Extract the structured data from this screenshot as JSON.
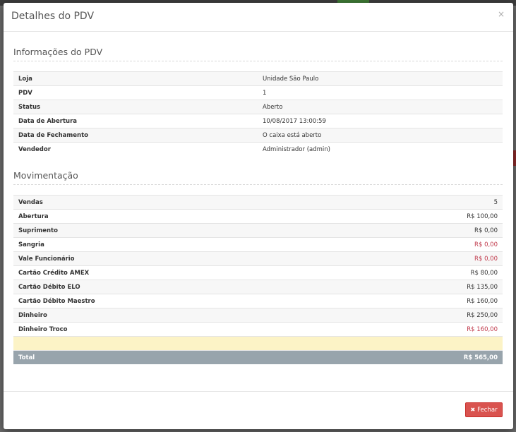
{
  "modal": {
    "title": "Detalhes do PDV",
    "close_glyph": "×",
    "close_button_label": "Fechar"
  },
  "info_section": {
    "title": "Informações do PDV",
    "rows": [
      {
        "label": "Loja",
        "value": "Unidade São Paulo"
      },
      {
        "label": "PDV",
        "value": "1"
      },
      {
        "label": "Status",
        "value": "Aberto"
      },
      {
        "label": "Data de Abertura",
        "value": "10/08/2017 13:00:59"
      },
      {
        "label": "Data de Fechamento",
        "value": "O caixa está aberto"
      },
      {
        "label": "Vendedor",
        "value": "Administrador (admin)"
      }
    ]
  },
  "mov_section": {
    "title": "Movimentação",
    "rows": [
      {
        "label": "Vendas",
        "value": "5",
        "negative": false
      },
      {
        "label": "Abertura",
        "value": "R$ 100,00",
        "negative": false
      },
      {
        "label": "Suprimento",
        "value": "R$ 0,00",
        "negative": false
      },
      {
        "label": "Sangria",
        "value": "R$ 0,00",
        "negative": true
      },
      {
        "label": "Vale Funcionário",
        "value": "R$ 0,00",
        "negative": true
      },
      {
        "label": "Cartão Crédito AMEX",
        "value": "R$ 80,00",
        "negative": false
      },
      {
        "label": "Cartão Débito ELO",
        "value": "R$ 135,00",
        "negative": false
      },
      {
        "label": "Cartão Débito Maestro",
        "value": "R$ 160,00",
        "negative": false
      },
      {
        "label": "Dinheiro",
        "value": "R$ 250,00",
        "negative": false
      },
      {
        "label": "Dinheiro Troco",
        "value": "R$ 160,00",
        "negative": true
      }
    ],
    "total_label": "Total",
    "total_value": "R$ 565,00"
  },
  "colors": {
    "negative": "#c0394b",
    "danger_button": "#d9534f",
    "total_row": "#98a4ac",
    "highlight_row": "#fcf3c6"
  }
}
